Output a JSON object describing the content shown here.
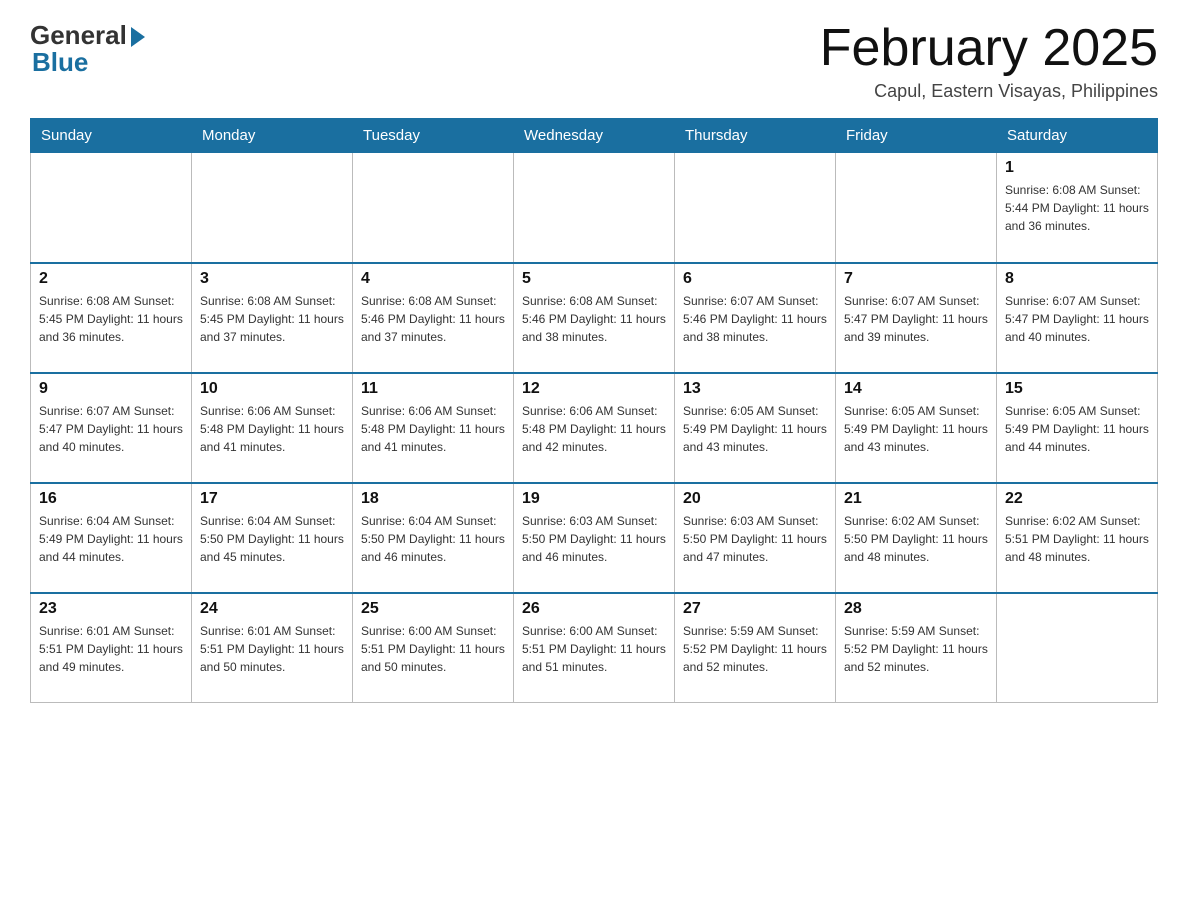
{
  "logo": {
    "general": "General",
    "blue": "Blue"
  },
  "header": {
    "title": "February 2025",
    "location": "Capul, Eastern Visayas, Philippines"
  },
  "days_of_week": [
    "Sunday",
    "Monday",
    "Tuesday",
    "Wednesday",
    "Thursday",
    "Friday",
    "Saturday"
  ],
  "weeks": [
    [
      {
        "day": "",
        "info": ""
      },
      {
        "day": "",
        "info": ""
      },
      {
        "day": "",
        "info": ""
      },
      {
        "day": "",
        "info": ""
      },
      {
        "day": "",
        "info": ""
      },
      {
        "day": "",
        "info": ""
      },
      {
        "day": "1",
        "info": "Sunrise: 6:08 AM\nSunset: 5:44 PM\nDaylight: 11 hours and 36 minutes."
      }
    ],
    [
      {
        "day": "2",
        "info": "Sunrise: 6:08 AM\nSunset: 5:45 PM\nDaylight: 11 hours and 36 minutes."
      },
      {
        "day": "3",
        "info": "Sunrise: 6:08 AM\nSunset: 5:45 PM\nDaylight: 11 hours and 37 minutes."
      },
      {
        "day": "4",
        "info": "Sunrise: 6:08 AM\nSunset: 5:46 PM\nDaylight: 11 hours and 37 minutes."
      },
      {
        "day": "5",
        "info": "Sunrise: 6:08 AM\nSunset: 5:46 PM\nDaylight: 11 hours and 38 minutes."
      },
      {
        "day": "6",
        "info": "Sunrise: 6:07 AM\nSunset: 5:46 PM\nDaylight: 11 hours and 38 minutes."
      },
      {
        "day": "7",
        "info": "Sunrise: 6:07 AM\nSunset: 5:47 PM\nDaylight: 11 hours and 39 minutes."
      },
      {
        "day": "8",
        "info": "Sunrise: 6:07 AM\nSunset: 5:47 PM\nDaylight: 11 hours and 40 minutes."
      }
    ],
    [
      {
        "day": "9",
        "info": "Sunrise: 6:07 AM\nSunset: 5:47 PM\nDaylight: 11 hours and 40 minutes."
      },
      {
        "day": "10",
        "info": "Sunrise: 6:06 AM\nSunset: 5:48 PM\nDaylight: 11 hours and 41 minutes."
      },
      {
        "day": "11",
        "info": "Sunrise: 6:06 AM\nSunset: 5:48 PM\nDaylight: 11 hours and 41 minutes."
      },
      {
        "day": "12",
        "info": "Sunrise: 6:06 AM\nSunset: 5:48 PM\nDaylight: 11 hours and 42 minutes."
      },
      {
        "day": "13",
        "info": "Sunrise: 6:05 AM\nSunset: 5:49 PM\nDaylight: 11 hours and 43 minutes."
      },
      {
        "day": "14",
        "info": "Sunrise: 6:05 AM\nSunset: 5:49 PM\nDaylight: 11 hours and 43 minutes."
      },
      {
        "day": "15",
        "info": "Sunrise: 6:05 AM\nSunset: 5:49 PM\nDaylight: 11 hours and 44 minutes."
      }
    ],
    [
      {
        "day": "16",
        "info": "Sunrise: 6:04 AM\nSunset: 5:49 PM\nDaylight: 11 hours and 44 minutes."
      },
      {
        "day": "17",
        "info": "Sunrise: 6:04 AM\nSunset: 5:50 PM\nDaylight: 11 hours and 45 minutes."
      },
      {
        "day": "18",
        "info": "Sunrise: 6:04 AM\nSunset: 5:50 PM\nDaylight: 11 hours and 46 minutes."
      },
      {
        "day": "19",
        "info": "Sunrise: 6:03 AM\nSunset: 5:50 PM\nDaylight: 11 hours and 46 minutes."
      },
      {
        "day": "20",
        "info": "Sunrise: 6:03 AM\nSunset: 5:50 PM\nDaylight: 11 hours and 47 minutes."
      },
      {
        "day": "21",
        "info": "Sunrise: 6:02 AM\nSunset: 5:50 PM\nDaylight: 11 hours and 48 minutes."
      },
      {
        "day": "22",
        "info": "Sunrise: 6:02 AM\nSunset: 5:51 PM\nDaylight: 11 hours and 48 minutes."
      }
    ],
    [
      {
        "day": "23",
        "info": "Sunrise: 6:01 AM\nSunset: 5:51 PM\nDaylight: 11 hours and 49 minutes."
      },
      {
        "day": "24",
        "info": "Sunrise: 6:01 AM\nSunset: 5:51 PM\nDaylight: 11 hours and 50 minutes."
      },
      {
        "day": "25",
        "info": "Sunrise: 6:00 AM\nSunset: 5:51 PM\nDaylight: 11 hours and 50 minutes."
      },
      {
        "day": "26",
        "info": "Sunrise: 6:00 AM\nSunset: 5:51 PM\nDaylight: 11 hours and 51 minutes."
      },
      {
        "day": "27",
        "info": "Sunrise: 5:59 AM\nSunset: 5:52 PM\nDaylight: 11 hours and 52 minutes."
      },
      {
        "day": "28",
        "info": "Sunrise: 5:59 AM\nSunset: 5:52 PM\nDaylight: 11 hours and 52 minutes."
      },
      {
        "day": "",
        "info": ""
      }
    ]
  ]
}
